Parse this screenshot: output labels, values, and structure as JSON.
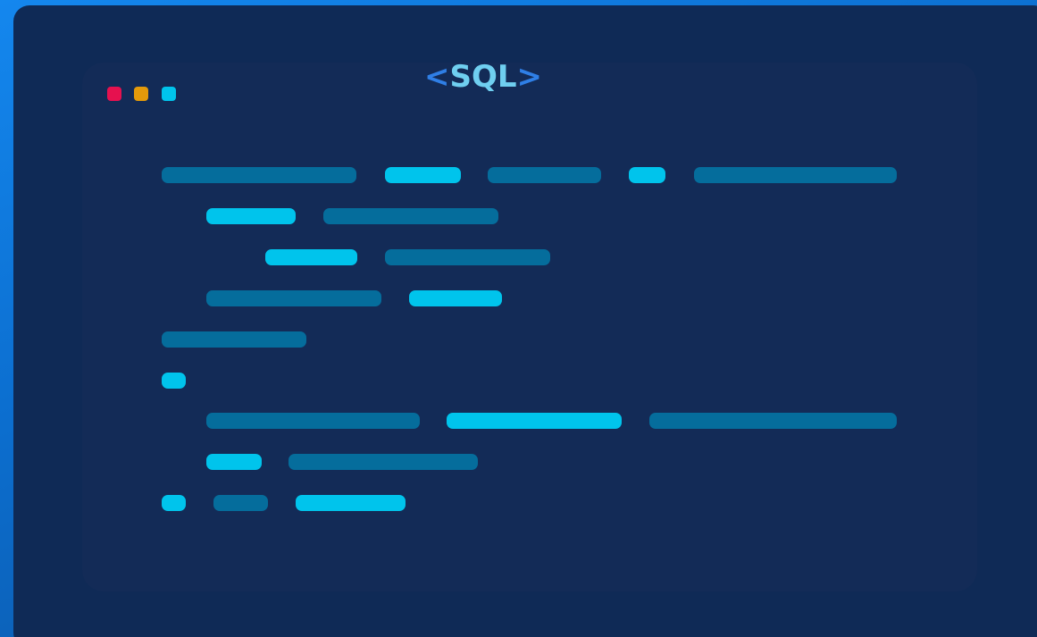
{
  "title": {
    "open_bracket": "<",
    "keyword": "SQL",
    "close_bracket": ">"
  },
  "window_controls": [
    {
      "name": "close-dot",
      "color": "#e6114f"
    },
    {
      "name": "minimize-dot",
      "color": "#e49a0a"
    },
    {
      "name": "maximize-dot",
      "color": "#00c4ec"
    }
  ],
  "colors": {
    "background": "#0d74d8",
    "panel": "#0f2a56",
    "window": "#132b57",
    "keyword_bar": "#00c4ec",
    "text_bar": "#056d9c",
    "bracket": "#2f7fe6",
    "title_text": "#6fcff0"
  }
}
